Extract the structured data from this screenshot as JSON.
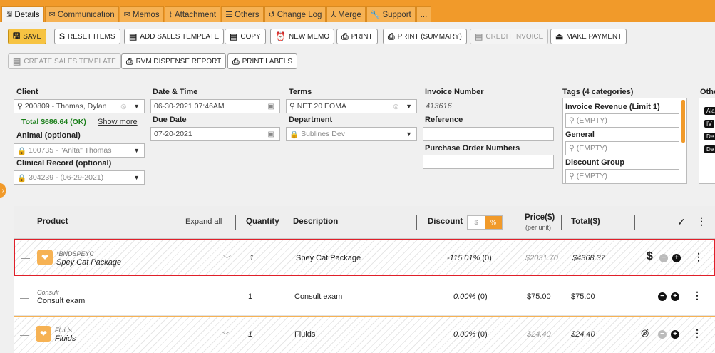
{
  "tabs": [
    {
      "label": "Details",
      "icon": "floppy-icon",
      "active": true
    },
    {
      "label": "Communication",
      "icon": "mail-icon"
    },
    {
      "label": "Memos",
      "icon": "mail-icon"
    },
    {
      "label": "Attachment",
      "icon": "paperclip-icon"
    },
    {
      "label": "Others",
      "icon": "list-icon"
    },
    {
      "label": "Change Log",
      "icon": "history-icon"
    },
    {
      "label": "Merge",
      "icon": "merge-icon"
    },
    {
      "label": "Support",
      "icon": "wrench-icon"
    },
    {
      "label": "...",
      "icon": ""
    }
  ],
  "toolbar": {
    "save": "SAVE",
    "reset_items": "RESET ITEMS",
    "add_sales_template": "ADD SALES TEMPLATE",
    "copy": "COPY",
    "new_memo": "NEW MEMO",
    "print": "PRINT",
    "print_summary": "PRINT (SUMMARY)",
    "credit_invoice": "CREDIT INVOICE",
    "make_payment": "MAKE PAYMENT",
    "create_sales_template": "CREATE SALES TEMPLATE",
    "rvm_dispense_report": "RVM DISPENSE REPORT",
    "print_labels": "PRINT LABELS"
  },
  "form": {
    "client_label": "Client",
    "client_value": "200809 - Thomas, Dylan",
    "total_text": "Total $686.64 (OK)",
    "show_more": "Show more",
    "animal_label": "Animal (optional)",
    "animal_value": "100735 - \"Anita\" Thomas",
    "clinical_label": "Clinical Record (optional)",
    "clinical_value": "304239 - (06-29-2021)",
    "datetime_label": "Date & Time",
    "datetime_value": "06-30-2021 07:46AM",
    "due_label": "Due Date",
    "due_value": "07-20-2021",
    "terms_label": "Terms",
    "terms_value": "NET 20 EOMA",
    "department_label": "Department",
    "department_value": "Sublines Dev",
    "invoice_label": "Invoice Number",
    "invoice_value": "413616",
    "reference_label": "Reference",
    "reference_value": "",
    "po_label": "Purchase Order Numbers",
    "po_value": "",
    "tags_label": "Tags (4 categories)",
    "tag_groups": [
      {
        "name": "Invoice Revenue (Limit 1)",
        "placeholder": "(EMPTY)"
      },
      {
        "name": "General",
        "placeholder": "(EMPTY)"
      },
      {
        "name": "Discount Group",
        "placeholder": "(EMPTY)"
      }
    ],
    "other_label": "Othe",
    "other_chips": [
      "Ala",
      "IV",
      "De",
      "De"
    ]
  },
  "grid": {
    "headers": {
      "product": "Product",
      "expand_all": "Expand all",
      "quantity": "Quantity",
      "description": "Description",
      "discount": "Discount",
      "discount_dollar": "$",
      "discount_pct": "%",
      "price": "Price($)",
      "price_sub": "(per unit)",
      "total": "Total($)"
    },
    "rows": [
      {
        "code": "*BNDSPEYC",
        "name": "Spey Cat Package",
        "qty": "1",
        "description": "Spey Cat Package",
        "discount": "-115.01%",
        "discount_amt": "(0)",
        "price": "$2031.70",
        "total": "$4368.37",
        "selected": true
      },
      {
        "code": "Consult",
        "name": "Consult exam",
        "qty": "1",
        "description": "Consult exam",
        "discount": "0.00%",
        "discount_amt": "(0)",
        "price": "$75.00",
        "total": "$75.00",
        "selected": false
      },
      {
        "code": "Fluids",
        "name": "Fluids",
        "qty": "1",
        "description": "Fluids",
        "discount": "0.00%",
        "discount_amt": "(0)",
        "price": "$24.40",
        "total": "$24.40",
        "selected": false
      }
    ]
  },
  "colors": {
    "accent": "#f19a2a",
    "selected_border": "#e0202a",
    "ok_green": "#1a7f1a"
  }
}
